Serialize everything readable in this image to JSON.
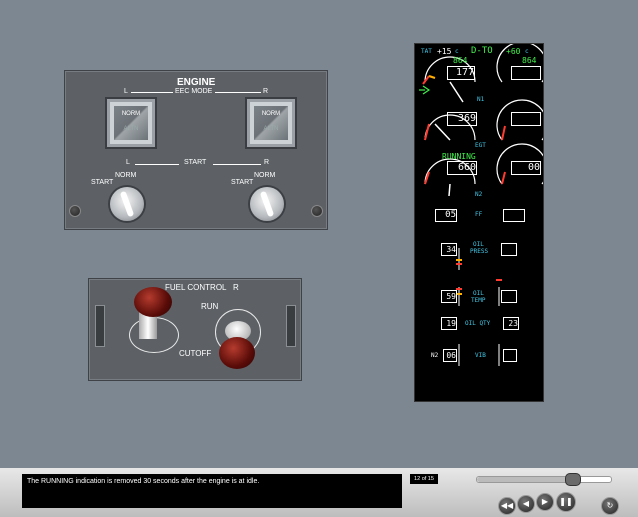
{
  "engine_panel": {
    "title": "ENGINE",
    "eec_mode": "EEC MODE",
    "left_side": "L",
    "right_side": "R",
    "left_button_label": "NORM",
    "left_button_sub": "ALTN",
    "right_button_label": "NORM",
    "right_button_sub": "ALTN",
    "start_title": "START",
    "start_left_side": "L",
    "start_right_side": "R",
    "start_left_pos1": "START",
    "start_left_pos2": "NORM",
    "start_right_pos1": "START",
    "start_right_pos2": "NORM"
  },
  "fuel_panel": {
    "title": "FUEL CONTROL",
    "side": "R",
    "run": "RUN",
    "cutoff": "CUTOFF"
  },
  "eicas": {
    "tat_label": "TAT",
    "tat_value": "+15",
    "tat_unit": "c",
    "mode": "D-TO",
    "mode_temp": "+60",
    "mode_temp_unit": "c",
    "n1_ref_left": "864",
    "n1_ref_right": "864",
    "n1_left": "177",
    "n1_label": "N1",
    "egt_left": "369",
    "egt_label": "EGT",
    "running": "RUNNING",
    "n2_left": "660",
    "n2_right": "00",
    "n2_label": "N2",
    "ff_left": "05",
    "ff_label": "FF",
    "oil_press_left": "34",
    "oil_press_label1": "OIL",
    "oil_press_label2": "PRESS",
    "oil_temp_left": "59",
    "oil_temp_label1": "OIL",
    "oil_temp_label2": "TEMP",
    "oil_qty_left": "19",
    "oil_qty_label": "OIL QTY",
    "oil_qty_right": "23",
    "vib_prefix": "N2",
    "vib_left": "06",
    "vib_label": "VIB"
  },
  "player": {
    "caption": "The RUNNING indication is removed 30 seconds after the engine is at idle.",
    "page": "12 of 15",
    "progress": 0.72,
    "buttons": {
      "rewind": "◀◀",
      "back": "◀",
      "forward": "▶",
      "pause": "❚❚",
      "replay": "↻"
    }
  }
}
